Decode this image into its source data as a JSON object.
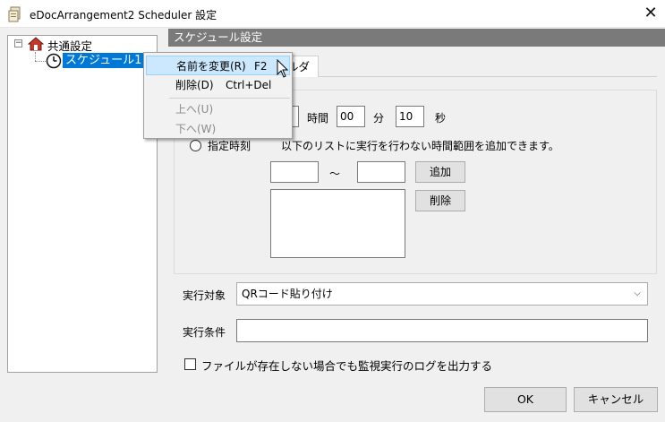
{
  "window": {
    "title": "eDocArrangement2 Scheduler 設定",
    "close_glyph": "✕"
  },
  "tree": {
    "expander_glyph": "−",
    "root_label": "共通設定",
    "child_label": "スケジュール1"
  },
  "panel": {
    "header": "スケジュール設定",
    "tab_partial": "ルダ"
  },
  "time": {
    "hour_unit": "時間",
    "minute_value": "00",
    "minute_unit": "分",
    "second_value": "10",
    "second_unit": "秒"
  },
  "exclusion": {
    "radio_label": "指定時刻",
    "description": "以下のリストに実行を行わない時間範囲を追加できます。",
    "from_value": "",
    "tilde": "～",
    "to_value": "",
    "add_button": "追加",
    "delete_button": "削除"
  },
  "target": {
    "label": "実行対象",
    "selected": "QRコード貼り付け",
    "dropdown_glyph": "⌵"
  },
  "condition": {
    "label": "実行条件",
    "value": ""
  },
  "log_checkbox": {
    "label": "ファイルが存在しない場合でも監視実行のログを出力する",
    "checked": false
  },
  "buttons": {
    "ok": "OK",
    "cancel": "キャンセル"
  },
  "context_menu": {
    "items": [
      {
        "label": "名前を変更(R)",
        "shortcut": "F2",
        "enabled": true,
        "highlighted": true
      },
      {
        "label": "削除(D)",
        "shortcut": "Ctrl+Del",
        "enabled": true,
        "highlighted": false
      },
      {
        "label": "上へ(U)",
        "shortcut": "",
        "enabled": false,
        "highlighted": false
      },
      {
        "label": "下へ(W)",
        "shortcut": "",
        "enabled": false,
        "highlighted": false
      }
    ]
  },
  "colors": {
    "selection": "#0078d7",
    "header_bar": "#7a7a7a",
    "menu_highlight": "#cce8ff"
  }
}
